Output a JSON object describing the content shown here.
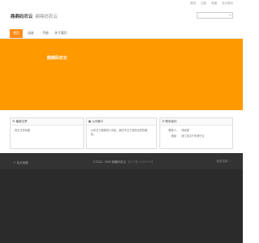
{
  "toplinks": [
    "登录",
    "注册",
    "收藏",
    "设为首页"
  ],
  "site": {
    "name": "鼎鼎码农云",
    "subtitle": "鼎鼎码农云"
  },
  "search": {
    "placeholder": "",
    "icon": "search-icon"
  },
  "nav": [
    {
      "label": "首页",
      "active": true
    },
    {
      "label": "动态",
      "active": false
    },
    {
      "label": "手册",
      "active": false
    },
    {
      "label": "关于我们",
      "active": false
    }
  ],
  "banner": {
    "title": "鼎鼎码农云",
    "color": "#ff9900"
  },
  "panels": {
    "recent": {
      "title": "最新文章",
      "items": [
        "暂无文章标题"
      ]
    },
    "about": {
      "title": "公司简介",
      "text": "公司位于美丽的沙河区，团队专注于提供优质的服务。"
    },
    "contact": {
      "title": "联系我们",
      "rows": [
        {
          "k": "联系人：",
          "v": "刘经理"
        },
        {
          "k": "地址：",
          "v": "浙江省嘉兴市海宁区"
        }
      ]
    }
  },
  "footer": {
    "left": "站点地图",
    "copyright": "© 2013 - 2020 鼎鼎码农云",
    "icp": "浙ICP备12345678号",
    "right": "返回顶部 ↑"
  },
  "colors": {
    "accent": "#ff8c1a",
    "footer": "#2b2b2b"
  }
}
